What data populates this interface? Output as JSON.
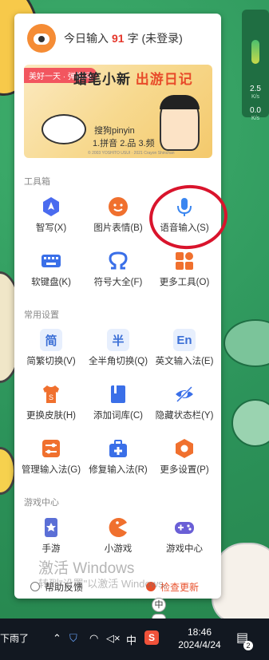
{
  "header": {
    "prefix": "今日输入",
    "count": "91",
    "suffix": "字",
    "status": "(未登录)"
  },
  "banner": {
    "tag": "美好一天 · 弹指间",
    "title_a": "蜡笔小新",
    "title_b": "出游日记",
    "line1": "搜狗pinyin",
    "line2": "1.拼音 2.品 3.频",
    "footnote": "© 2003 YOSHITO USUI · 2021 Crayon Shinchan"
  },
  "sections": {
    "tools": "工具箱",
    "settings": "常用设置",
    "games": "游戏中心"
  },
  "tools": [
    {
      "label": "智写(X)",
      "icon": "smart-write-icon"
    },
    {
      "label": "图片表情(B)",
      "icon": "emoji-icon"
    },
    {
      "label": "语音输入(S)",
      "icon": "microphone-icon"
    },
    {
      "label": "软键盘(K)",
      "icon": "keyboard-icon"
    },
    {
      "label": "符号大全(F)",
      "icon": "omega-icon"
    },
    {
      "label": "更多工具(O)",
      "icon": "grid-icon"
    }
  ],
  "settings": [
    {
      "label": "简繁切换(V)",
      "badge": "简"
    },
    {
      "label": "全半角切换(Q)",
      "badge": "半"
    },
    {
      "label": "英文输入法(E)",
      "badge": "En"
    },
    {
      "label": "更换皮肤(H)",
      "icon": "shirt-icon"
    },
    {
      "label": "添加词库(C)",
      "icon": "book-icon"
    },
    {
      "label": "隐藏状态栏(Y)",
      "icon": "eye-off-icon"
    },
    {
      "label": "管理输入法(G)",
      "icon": "sliders-icon"
    },
    {
      "label": "修复输入法(R)",
      "icon": "toolbox-icon"
    },
    {
      "label": "更多设置(P)",
      "icon": "settings-hex-icon"
    }
  ],
  "games": [
    {
      "label": "手游",
      "icon": "mobile-game-icon"
    },
    {
      "label": "小游戏",
      "icon": "pacman-icon"
    },
    {
      "label": "游戏中心",
      "icon": "gamepad-icon"
    }
  ],
  "footer": {
    "feedback": "帮助反馈",
    "update": "检查更新"
  },
  "watermark": {
    "line1": "激活 Windows",
    "line2": "转到\"设置\"以激活 Windows。"
  },
  "netmon": {
    "up": "2.5",
    "up_unit": "K/s",
    "down": "0.0",
    "down_unit": "K/s"
  },
  "ime_chips": [
    "中",
    "🐻"
  ],
  "taskbar": {
    "weather": "下雨了",
    "ime_lang": "中",
    "sogou": "S",
    "time": "18:46",
    "date": "2024/4/24",
    "notifications": "2"
  },
  "colors": {
    "accent_red": "#e5372b",
    "tool_blue": "#3b6fd6",
    "orange": "#f06a2b",
    "annotation": "#d9142c"
  }
}
